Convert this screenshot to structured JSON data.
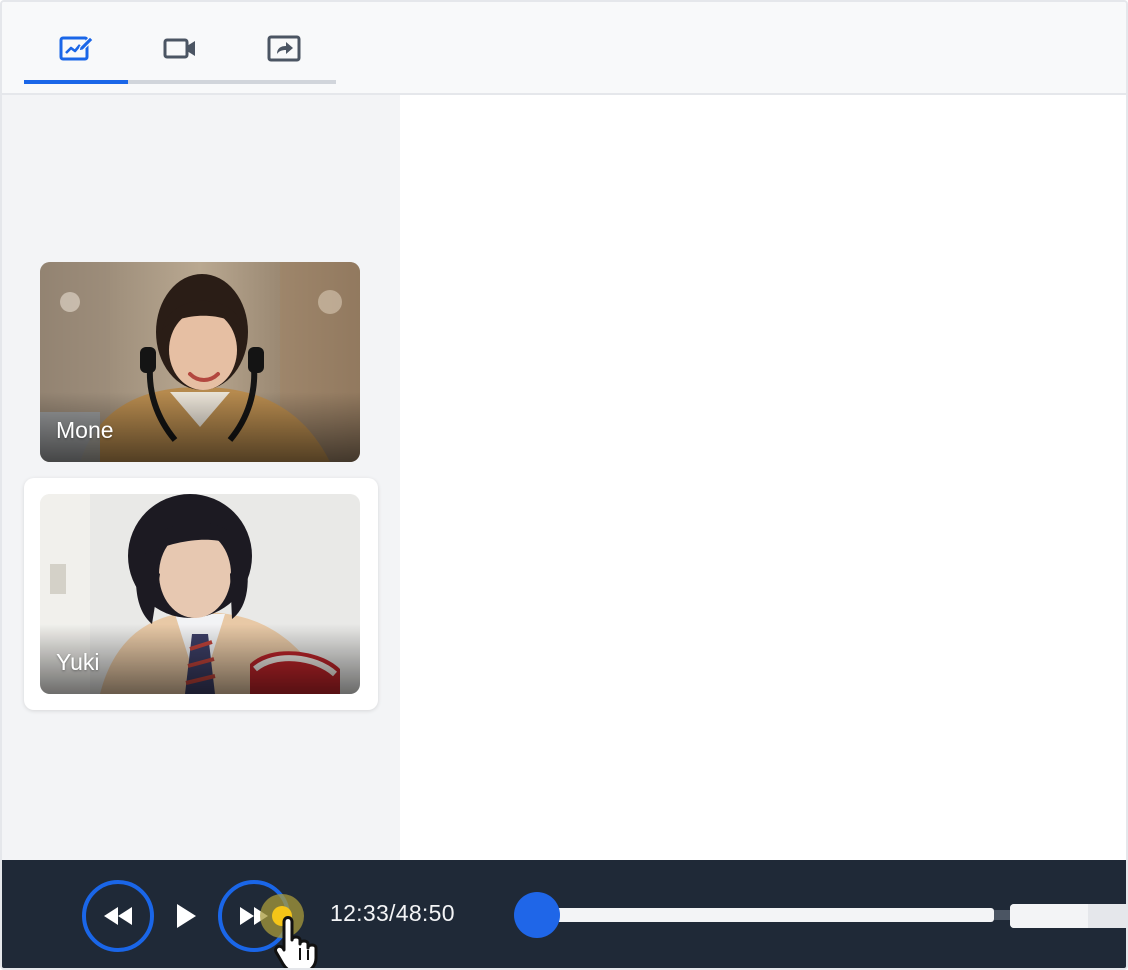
{
  "toolbar": {
    "tabs": [
      {
        "icon": "whiteboard-icon",
        "active": true
      },
      {
        "icon": "video-camera-icon",
        "active": false
      },
      {
        "icon": "screen-share-icon",
        "active": false
      }
    ]
  },
  "participants": [
    {
      "name": "Mone",
      "selected": false
    },
    {
      "name": "Yuki",
      "selected": true
    }
  ],
  "player": {
    "time": "12:33/48:50",
    "progress": 0.0,
    "volume": 0.64,
    "rewind_icon": "rewind-icon",
    "play_icon": "play-icon",
    "fast_forward_icon": "fast-forward-icon"
  },
  "colors": {
    "accent": "#1a66e8",
    "player_bg": "#1f2937",
    "sidebar_bg": "#f3f4f6",
    "touch_highlight": "#f5c518"
  }
}
